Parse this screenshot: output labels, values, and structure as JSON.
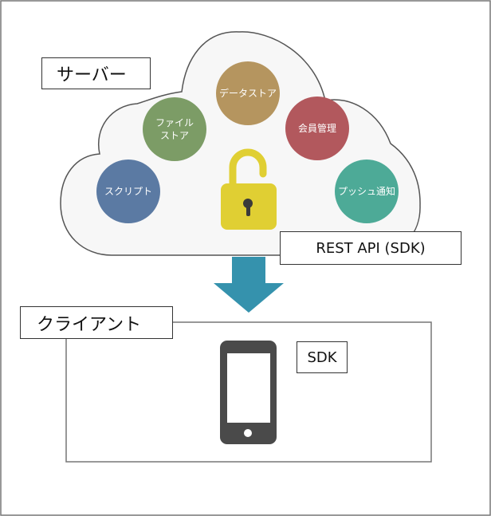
{
  "server": {
    "label": "サーバー"
  },
  "services": [
    {
      "label_lines": [
        "データストア"
      ],
      "color": "#b5955f"
    },
    {
      "label_lines": [
        "ファイル",
        "ストア"
      ],
      "color": "#7c9c66"
    },
    {
      "label_lines": [
        "会員管理"
      ],
      "color": "#b2585d"
    },
    {
      "label_lines": [
        "スクリプト"
      ],
      "color": "#5b7aa3"
    },
    {
      "label_lines": [
        "プッシュ通知"
      ],
      "color": "#4daa97"
    }
  ],
  "lock": {
    "icon": "padlock-open-icon",
    "color": "#e0cf33"
  },
  "api": {
    "label": "REST API (SDK)"
  },
  "arrow": {
    "icon": "down-arrow-icon",
    "color": "#3592ad"
  },
  "client": {
    "label": "クライアント",
    "sdk_label": "SDK"
  },
  "phone": {
    "icon": "smartphone-icon",
    "color": "#4a4a4a"
  }
}
